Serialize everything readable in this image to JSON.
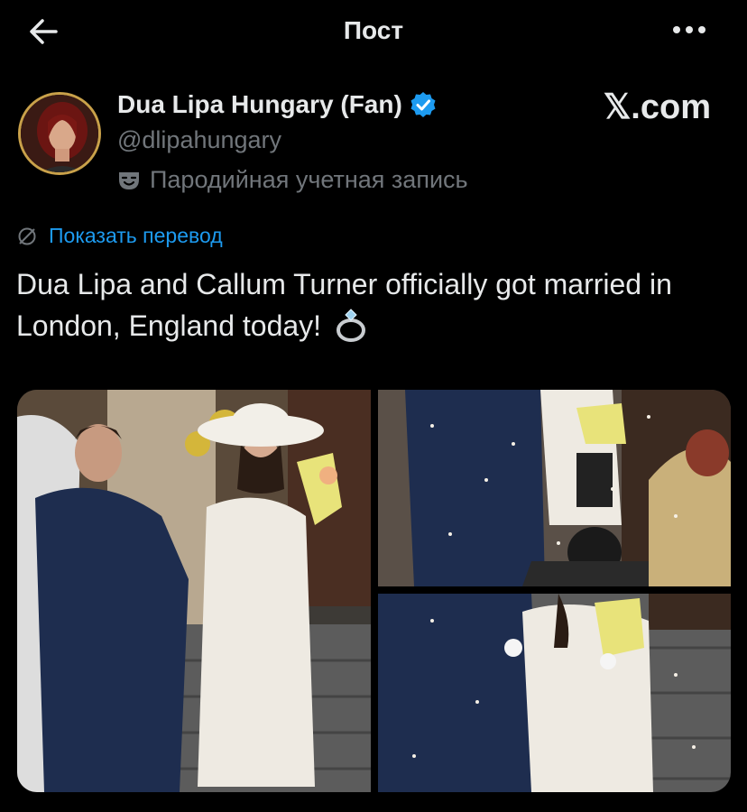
{
  "header": {
    "title": "Пост",
    "back_icon": "arrow-left-icon",
    "more_icon": "more-dots-icon"
  },
  "author": {
    "name": "Dua Lipa Hungary (Fan)",
    "handle": "@dlipahungary",
    "parody_label": "Пародийная учетная запись",
    "verified": true,
    "verified_color": "#1d9bf0"
  },
  "watermark": "𝕏.com",
  "translate_link": "Показать перевод",
  "tweet": {
    "text": "Dua Lipa and Callum Turner officially got married in London, England today!",
    "emoji": "ring"
  },
  "media": {
    "count": 3,
    "items": [
      "photo-couple-steps",
      "photo-couple-confetti",
      "photo-couple-closeup"
    ]
  },
  "colors": {
    "background": "#000000",
    "text": "#e7e9ea",
    "secondary": "#71767b",
    "accent": "#1d9bf0"
  }
}
